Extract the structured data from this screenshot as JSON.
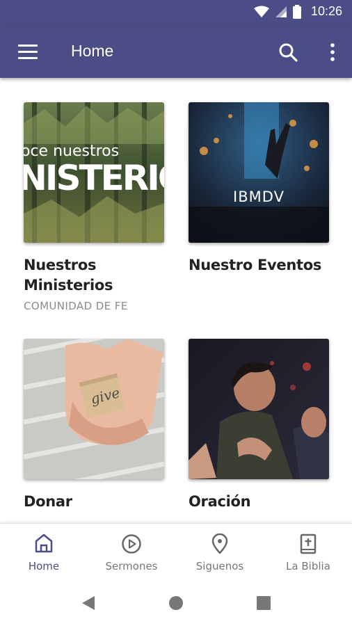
{
  "status_bar": {
    "time": "10:26"
  },
  "app_bar": {
    "title": "Home"
  },
  "cards": [
    {
      "title": "Nuestros Ministerios",
      "subtitle": "COMUNIDAD DE FE",
      "image_text_small": "oce nuestros",
      "image_text_large": "NISTERIOS"
    },
    {
      "title": "Nuestro Eventos",
      "image_text": "IBMDV"
    },
    {
      "title": "Donar",
      "image_text": "give"
    },
    {
      "title": "Oración"
    }
  ],
  "bottom_nav": [
    {
      "label": "Home",
      "icon": "home-icon",
      "active": true
    },
    {
      "label": "Sermones",
      "icon": "play-circle-icon",
      "active": false
    },
    {
      "label": "Siguenos",
      "icon": "location-pin-icon",
      "active": false
    },
    {
      "label": "La Biblia",
      "icon": "bible-icon",
      "active": false
    }
  ],
  "colors": {
    "primary": "#4b4d86",
    "text": "#222222",
    "muted": "#8a8a8a"
  }
}
